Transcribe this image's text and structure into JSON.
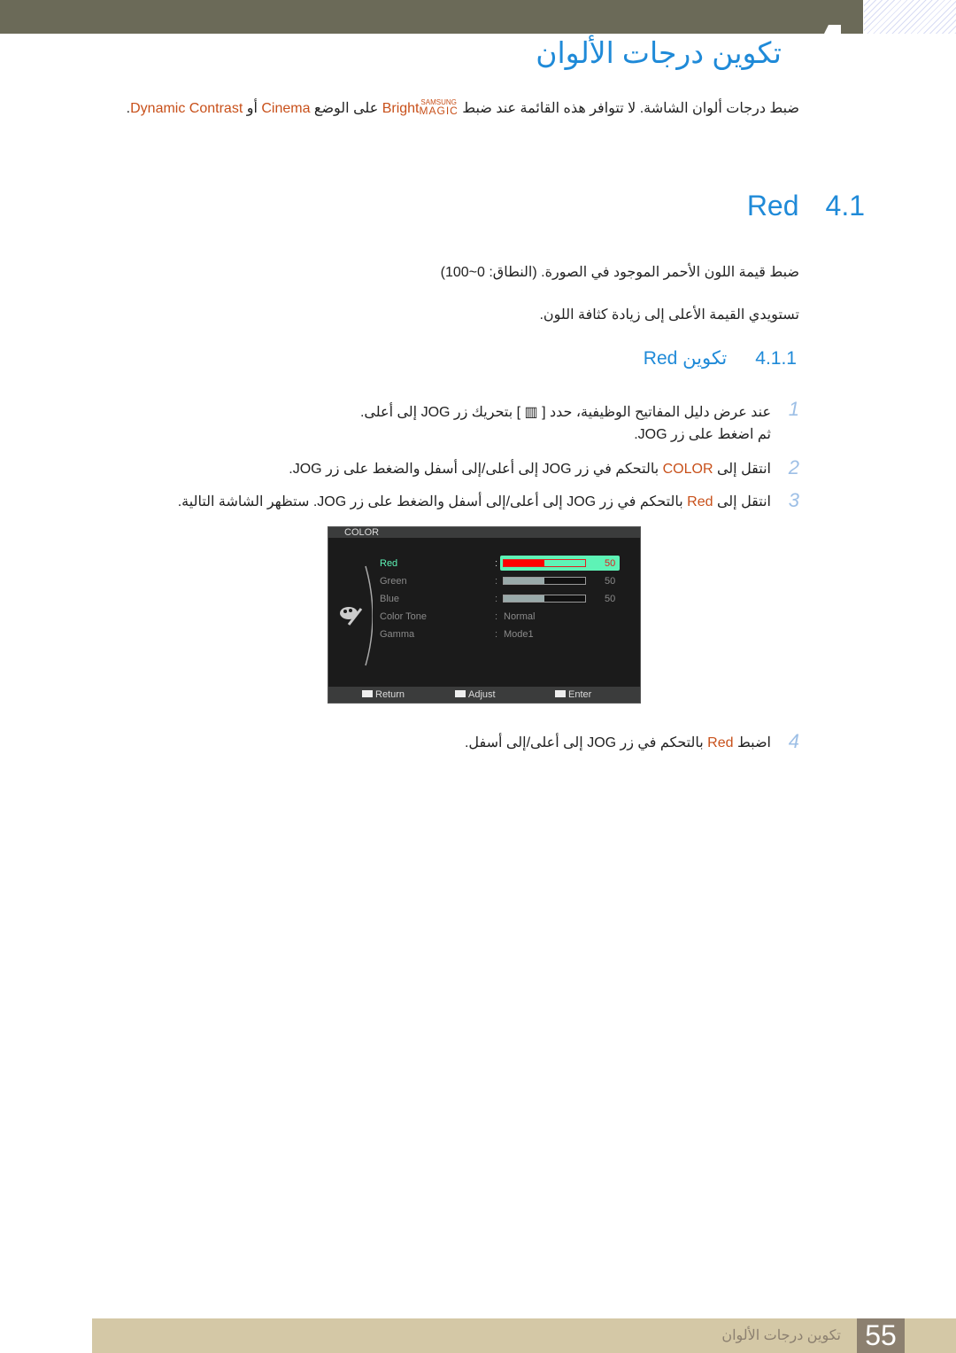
{
  "header": {
    "title": "تكوين درجات الألوان"
  },
  "intro": {
    "text1": "ضبط درجات ألوان الشاشة. لا تتوافر هذه القائمة عند ضبط ",
    "magic_top": "SAMSUNG",
    "magic_bottom": "MAGIC",
    "bright": "Bright",
    "text2": " على الوضع ",
    "cinema": "Cinema",
    "text3": " أو ",
    "dynamic": "Dynamic Contrast",
    "end": "."
  },
  "section": {
    "number": "4.1",
    "title": "Red",
    "desc1": "ضبط قيمة اللون الأحمر الموجود في الصورة. (النطاق: 0~100)",
    "desc2": "تستويدي القيمة الأعلى إلى زيادة كثافة اللون."
  },
  "subsection": {
    "number": "4.1.1",
    "title": "تكوين Red"
  },
  "steps": [
    {
      "n": "1",
      "line1": "عند عرض دليل المفاتيح الوظيفية، حدد [ ▥ ] بتحريك زر JOG إلى أعلى.",
      "line2": "ثم اضغط على زر JOG."
    },
    {
      "n": "2",
      "pre": "انتقل إلى ",
      "hl": "COLOR",
      "post": " بالتحكم في زر JOG إلى أعلى/إلى أسفل والضغط على زر JOG."
    },
    {
      "n": "3",
      "pre": "انتقل إلى ",
      "hl": "Red",
      "post": " بالتحكم في زر JOG إلى أعلى/إلى أسفل والضغط على زر JOG. ستظهر الشاشة التالية."
    },
    {
      "n": "4",
      "pre": "اضبط ",
      "hl": "Red",
      "post": " بالتحكم في زر JOG إلى أعلى/إلى أسفل."
    }
  ],
  "osd": {
    "title": "COLOR",
    "items": [
      {
        "label": "Red",
        "value": "50",
        "level": 50
      },
      {
        "label": "Green",
        "value": "50",
        "level": 50
      },
      {
        "label": "Blue",
        "value": "50",
        "level": 50
      },
      {
        "label": "Color Tone",
        "value": "Normal"
      },
      {
        "label": "Gamma",
        "value": "Mode1"
      }
    ],
    "footer": {
      "return": "Return",
      "adjust": "Adjust",
      "enter": "Enter"
    },
    "colors": {
      "selected": "#5ef3b6",
      "red": "#ff0000"
    }
  },
  "footer": {
    "chapter": "تكوين درجات الألوان",
    "page": "55"
  }
}
